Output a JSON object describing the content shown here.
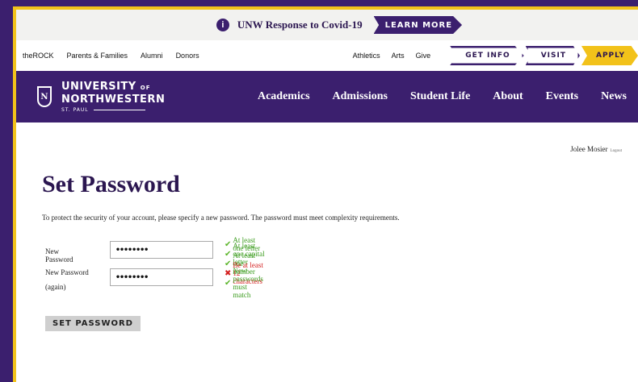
{
  "covid_banner": {
    "info_icon": "info-icon",
    "text": "UNW Response to Covid-19",
    "button": "LEARN MORE"
  },
  "utility_nav": {
    "left": [
      "theROCK",
      "Parents & Families",
      "Alumni",
      "Donors"
    ],
    "right": [
      "Athletics",
      "Arts",
      "Give"
    ],
    "cta": [
      "GET INFO",
      "VISIT",
      "APPLY"
    ]
  },
  "logo": {
    "line1": "UNIVERSITY",
    "line1_small": "OF",
    "line2": "NORTHWESTERN",
    "line3": "ST. PAUL"
  },
  "main_nav": [
    "Academics",
    "Admissions",
    "Student Life",
    "About",
    "Events",
    "News"
  ],
  "user": {
    "name": "Jolee Mosier",
    "logout": "Logout"
  },
  "page": {
    "title": "Set Password",
    "intro": "To protect the security of your account, please specify a new password. The password must meet complexity requirements."
  },
  "form": {
    "new_password_label": "New Password",
    "new_password_value": "••••••••",
    "again_label_line1": "New Password",
    "again_label_line2": "(again)",
    "again_value": "••••••••",
    "submit": "SET PASSWORD"
  },
  "rules": [
    {
      "text": "At least one letter",
      "status": "ok"
    },
    {
      "text": "At least one capital letter",
      "status": "ok"
    },
    {
      "text": "At least one number",
      "status": "ok"
    },
    {
      "text": "Be at least 12 characters",
      "status": "bad"
    },
    {
      "text": "New passwords must match",
      "status": "ok"
    }
  ],
  "colors": {
    "brand_purple": "#3b1f6e",
    "brand_gold": "#f2c21a",
    "ok_green": "#3b9c1e",
    "error_red": "#d42020"
  }
}
